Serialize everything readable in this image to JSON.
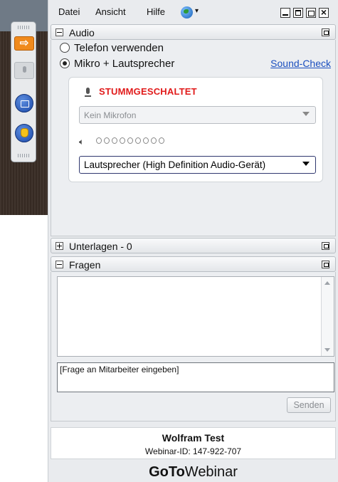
{
  "menu": {
    "file": "Datei",
    "view": "Ansicht",
    "help": "Hilfe",
    "globe_caret": "▾"
  },
  "audio": {
    "title": "Audio",
    "options": [
      {
        "label": "Telefon verwenden",
        "selected": false
      },
      {
        "label": "Mikro + Lautsprecher",
        "selected": true
      }
    ],
    "sound_check": "Sound-Check",
    "muted_status": "STUMMGESCHALTET",
    "microphone_select": "Kein Mikrofon",
    "speaker_select": "Lautsprecher (High Definition Audio-Gerät)",
    "speaker_level_segments": 9,
    "speaker_level_active": 0
  },
  "handouts": {
    "title": "Unterlagen - 0"
  },
  "questions": {
    "title": "Fragen",
    "input_value": "[Frage an Mitarbeiter eingeben]",
    "send_label": "Senden"
  },
  "footer": {
    "name": "Wolfram Test",
    "webinar_id": "Webinar-ID: 147-922-707",
    "brand_bold": "GoTo",
    "brand_regular": "Webinar"
  },
  "colors": {
    "muted_red": "#e11b1b",
    "link_blue": "#1b4fbf",
    "toolbar_orange": "#f08a1c",
    "toolbar_blue": "#1a48a8"
  },
  "icons": [
    "grab-tab-icon",
    "microphone-icon",
    "screen-icon",
    "raise-hand-icon",
    "globe-icon",
    "speaker-icon"
  ]
}
